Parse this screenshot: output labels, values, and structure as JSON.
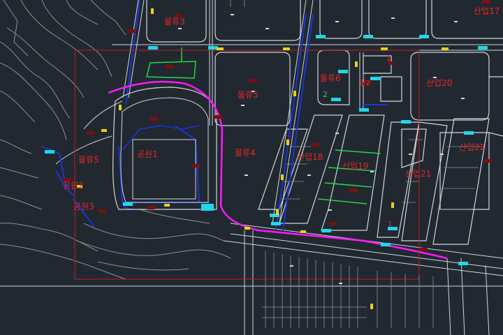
{
  "drawing": {
    "background": "#212830",
    "colors": {
      "line_white": "#cfd6dc",
      "line_gray": "#8a9298",
      "boundary_red": "#c81e1e",
      "route_magenta": "#ff18ff",
      "road_blue": "#1b35d8",
      "green": "#22d64a",
      "cyan": "#1fd8e8",
      "yellow": "#e8d21c",
      "dark_red": "#7a1010"
    },
    "labels": {
      "mulryu3_top": "물류3",
      "sanup17": "산업17",
      "mulryu6": "물류6",
      "mulryu5": "물류5",
      "sanup20": "산업20",
      "num2": "2",
      "gongwon1": "공원1",
      "mulryu4": "물류4",
      "sanup18": "산업18",
      "sanup19": "산업19",
      "sanup22": "산업22",
      "sanup21": "산업21",
      "mulryu5_left": "물류5",
      "gongwon2_left": "공원2",
      "gongwon3": "공원3",
      "ganri2": "관2",
      "small_bl": "1",
      "small_top": "1"
    }
  }
}
